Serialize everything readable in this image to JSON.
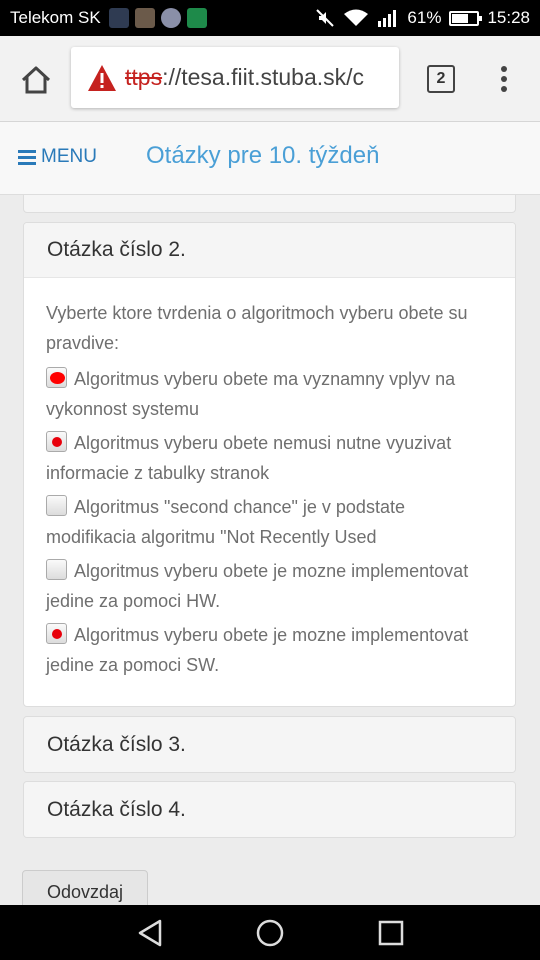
{
  "status_bar": {
    "carrier": "Telekom SK",
    "battery": "61%",
    "battery_level": 0.61,
    "time": "15:28"
  },
  "browser": {
    "url_scheme": "ttps",
    "url_rest": "://tesa.fiit.stuba.sk/c",
    "tab_count": "2"
  },
  "header": {
    "menu_label": "MENU",
    "page_title": "Otázky pre 10. týždeň"
  },
  "panels": [
    {
      "title": "Otázka číslo 2.",
      "question": "Vyberte ktore tvrdenia o algoritmoch vyberu obete su pravdive:",
      "options": [
        {
          "text": "Algoritmus vyberu obete ma vyznamny vplyv na vykonnost systemu",
          "checked": true
        },
        {
          "text": "Algoritmus vyberu obete nemusi nutne vyuzivat informacie z tabulky stranok",
          "checked": true
        },
        {
          "text": "Algoritmus \"second chance\" je v podstate modifikacia algoritmu \"Not Recently Used",
          "checked": false
        },
        {
          "text": "Algoritmus vyberu obete je mozne implementovat jedine za pomoci HW.",
          "checked": false
        },
        {
          "text": "Algoritmus vyberu obete je mozne implementovat jedine za pomoci SW.",
          "checked": true
        }
      ]
    },
    {
      "title": "Otázka číslo 3."
    },
    {
      "title": "Otázka číslo 4."
    }
  ],
  "submit_label": "Odovzdaj",
  "colors": {
    "link_blue": "#2a7ab9",
    "title_blue": "#4a9fd6",
    "warning_red": "#c5221f",
    "checkbox_mark": "#e8000b"
  },
  "icons": {
    "home": "home-icon",
    "warning": "warning-triangle-icon",
    "menu": "hamburger-icon",
    "more": "more-vertical-icon",
    "back": "back-triangle-icon",
    "nav_home": "circle-home-icon",
    "recent": "square-recent-icon"
  }
}
